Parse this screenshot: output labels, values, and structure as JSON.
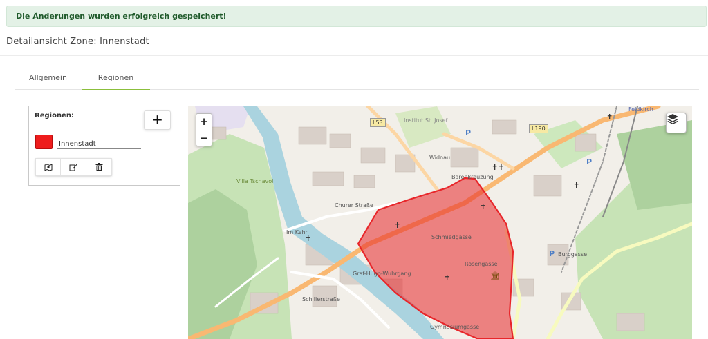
{
  "alert": {
    "message": "Die Änderungen wurden erfolgreich gespeichert!"
  },
  "page": {
    "title": "Detailansicht Zone: Innenstadt"
  },
  "tabs": [
    {
      "label": "Allgemein",
      "active": false
    },
    {
      "label": "Regionen",
      "active": true
    }
  ],
  "regions_panel": {
    "title": "Regionen:",
    "add_label": "+",
    "regions": [
      {
        "name": "Innenstadt",
        "color": "#ee1c1c"
      }
    ],
    "actions": [
      "map-icon",
      "edit-icon",
      "trash-icon"
    ]
  },
  "map": {
    "zoom_in": "+",
    "zoom_out": "−",
    "labels": {
      "feldkirch": "Feldkirch",
      "l53": "L53",
      "l190": "L190",
      "villa": "Villa Tschavoll",
      "churer": "Churer Straße",
      "im_kehr": "Im Kehr",
      "widnau": "Widnau",
      "baerenkreuzung": "Bärenkreuzung",
      "schmiedgasse": "Schmiedgasse",
      "rosengasse": "Rosengasse",
      "burggasse": "Burggasse",
      "gymnasiumgasse": "Gymnasiumgasse",
      "institut": "Institut St. Josef",
      "schillerstrasse": "Schillerstraße",
      "hugo_wuhrgang": "Graf-Hugo-Wuhrgang"
    },
    "polygon_color": "#e8262a"
  }
}
